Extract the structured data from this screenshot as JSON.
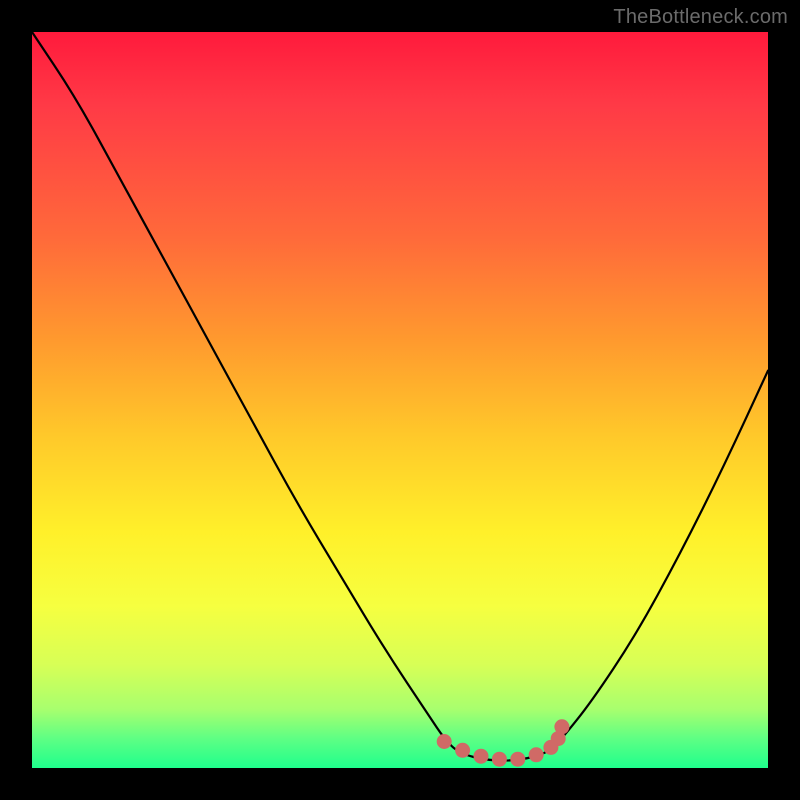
{
  "watermark": {
    "text": "TheBottleneck.com"
  },
  "chart_data": {
    "type": "line",
    "title": "",
    "xlabel": "",
    "ylabel": "",
    "xlim": [
      0,
      100
    ],
    "ylim": [
      0,
      100
    ],
    "grid": false,
    "legend": false,
    "background": "red-yellow-green vertical gradient",
    "series": [
      {
        "name": "bottleneck-curve",
        "color": "#000000",
        "x": [
          0,
          6,
          12,
          18,
          24,
          30,
          36,
          42,
          48,
          54,
          56,
          58,
          62,
          66,
          70,
          72,
          76,
          82,
          88,
          94,
          100
        ],
        "y": [
          100,
          91,
          80,
          69,
          58,
          47,
          36,
          26,
          16,
          7,
          4,
          2,
          1,
          1,
          2,
          4,
          9,
          18,
          29,
          41,
          54
        ]
      }
    ],
    "highlight": {
      "name": "optimal-range-dots",
      "color": "#d06a66",
      "points_x": [
        56,
        58.5,
        61,
        63.5,
        66,
        68.5,
        70.5,
        71.5,
        72
      ],
      "points_y": [
        3.6,
        2.4,
        1.6,
        1.2,
        1.2,
        1.8,
        2.8,
        4.0,
        5.6
      ]
    }
  }
}
